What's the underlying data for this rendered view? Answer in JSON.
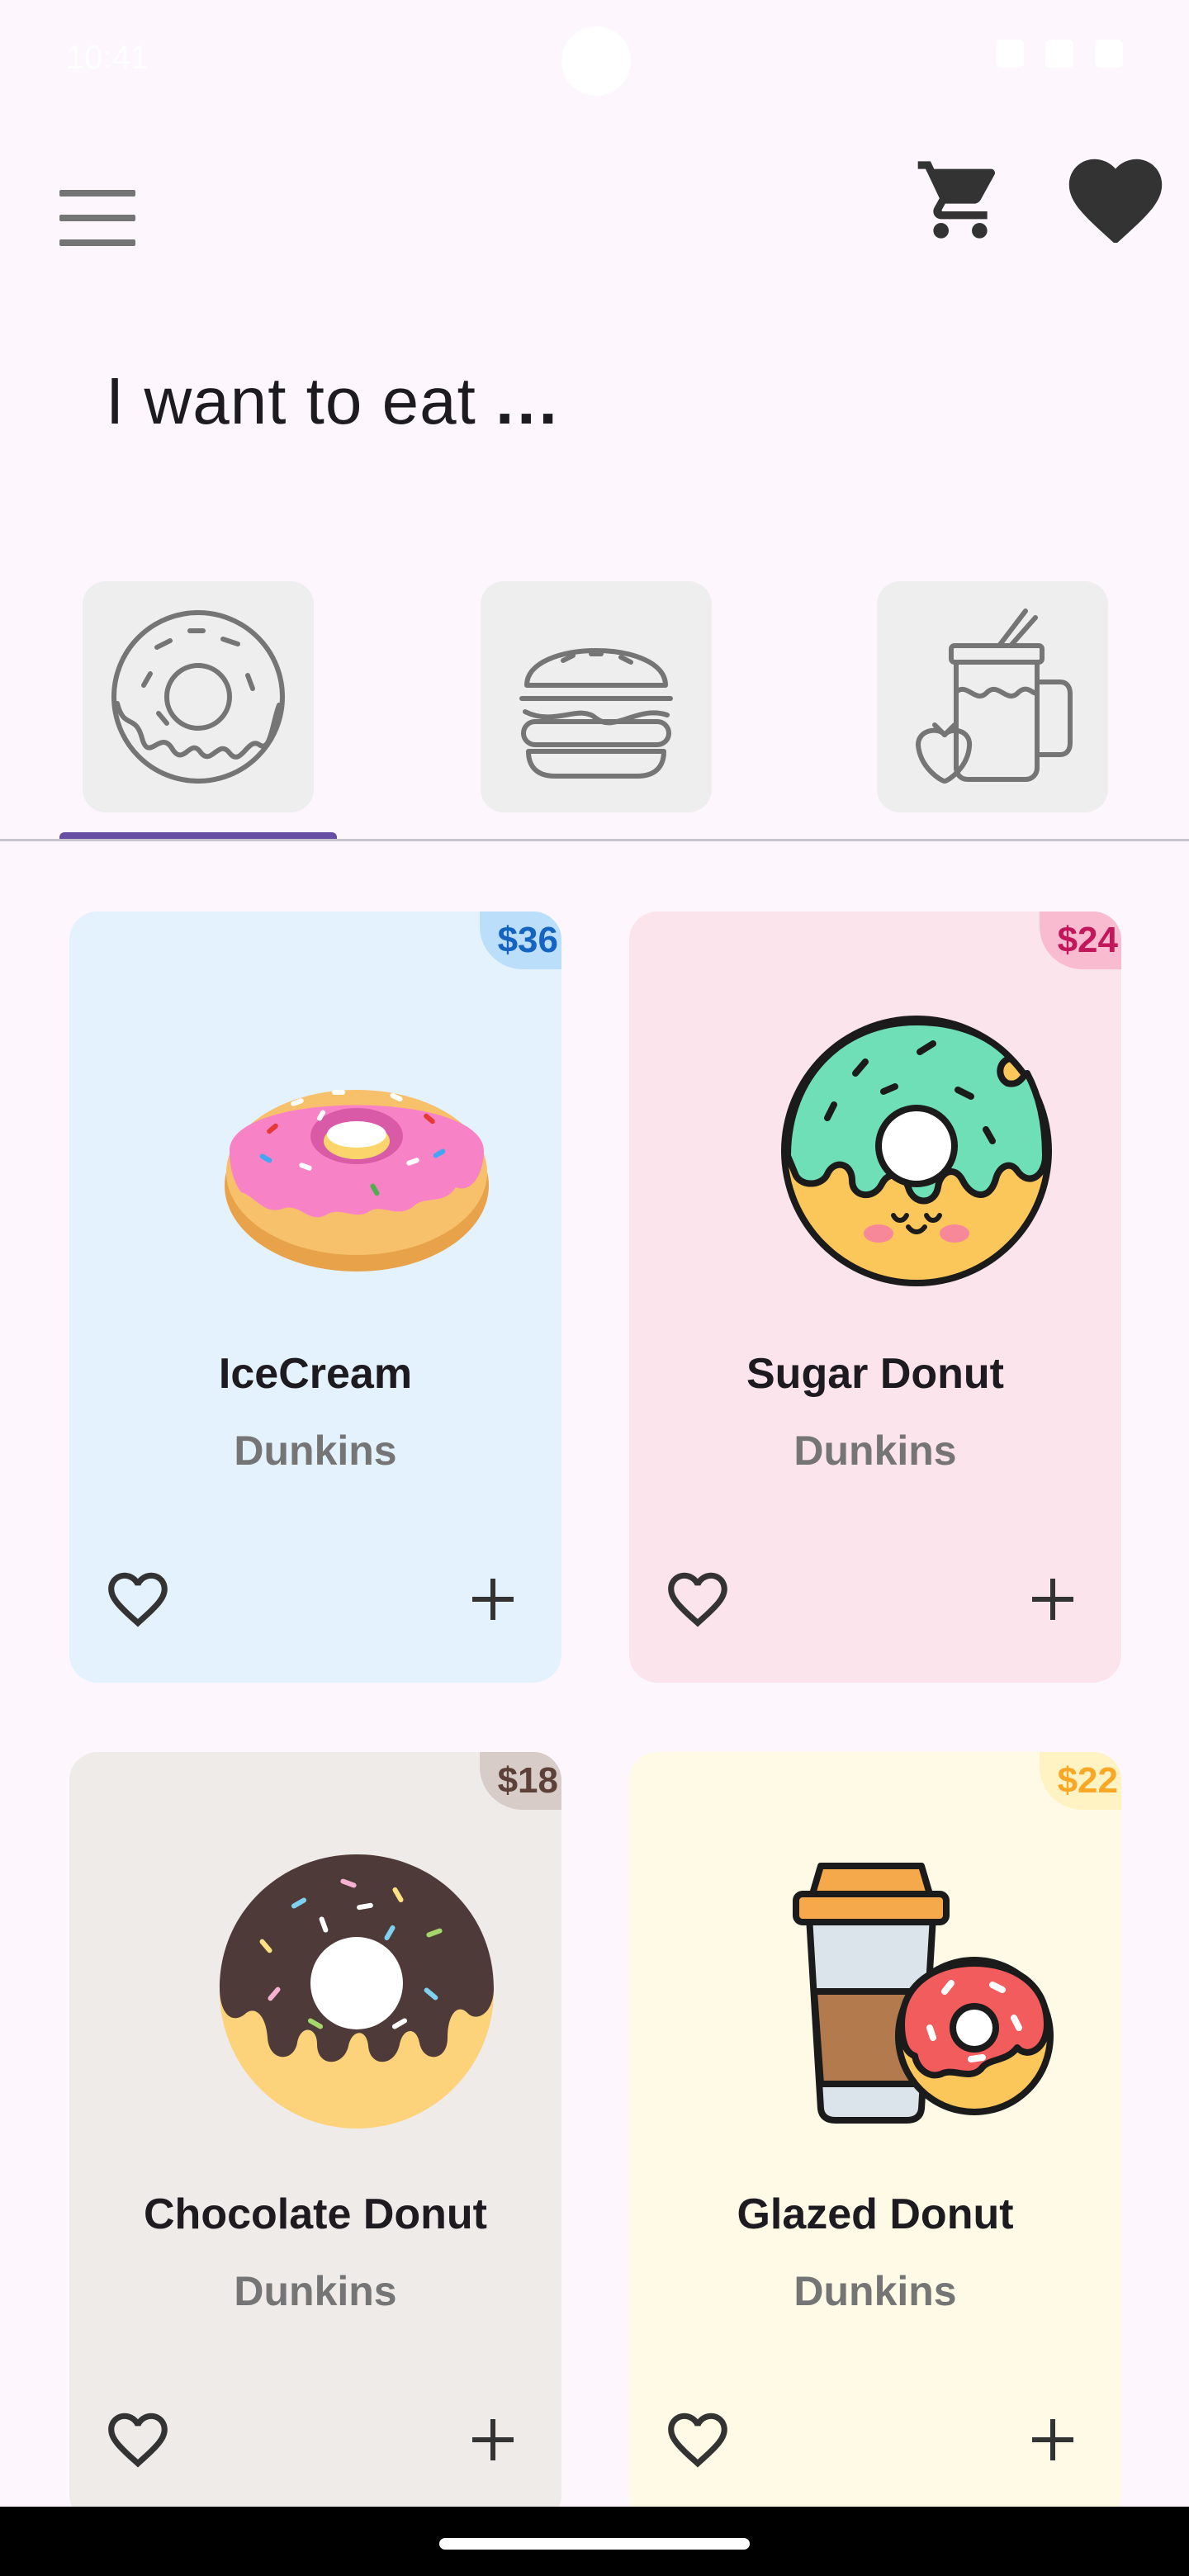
{
  "status_bar": {
    "time": "10:41"
  },
  "header": {
    "menu_icon": "hamburger-menu-icon",
    "cart_icon": "shopping-cart-icon",
    "favorites_icon": "heart-filled-icon"
  },
  "headline": {
    "text": "I want to eat",
    "dots": "..."
  },
  "tabs": [
    {
      "icon": "donut-icon",
      "selected": true
    },
    {
      "icon": "burger-icon",
      "selected": false
    },
    {
      "icon": "smoothie-icon",
      "selected": false
    }
  ],
  "colors": {
    "accent": "#6750a4",
    "background": "#fdf7fd",
    "tab_background": "#eeeeee"
  },
  "products": [
    {
      "name": "IceCream",
      "brand": "Dunkins",
      "price": "$36",
      "card_color": "#e3f2fd",
      "price_bg": "#bbdefb",
      "price_color": "#1565c0",
      "image": "pink-donut-icon"
    },
    {
      "name": "Sugar Donut",
      "brand": "Dunkins",
      "price": "$24",
      "card_color": "#fce4ec",
      "price_bg": "#f8bbd0",
      "price_color": "#c2185b",
      "image": "mint-donut-icon"
    },
    {
      "name": "Chocolate Donut",
      "brand": "Dunkins",
      "price": "$18",
      "card_color": "#efebe9",
      "price_bg": "#d7ccc8",
      "price_color": "#5d4037",
      "image": "chocolate-donut-icon"
    },
    {
      "name": "Glazed Donut",
      "brand": "Dunkins",
      "price": "$22",
      "card_color": "#fffae6",
      "price_bg": "#fff3c4",
      "price_color": "#f9a825",
      "image": "coffee-donut-icon"
    }
  ]
}
